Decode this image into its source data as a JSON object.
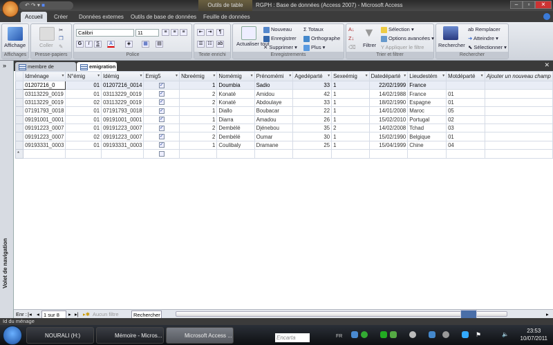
{
  "window": {
    "context_tab": "Outils de table",
    "title": "RGPH : Base de données (Access 2007) - Microsoft Access",
    "min": "–",
    "max": "▫",
    "close": "✕"
  },
  "ribbon_tabs": [
    "Accueil",
    "Créer",
    "Données externes",
    "Outils de base de données",
    "Feuille de données"
  ],
  "ribbon": {
    "affichages": {
      "button": "Affichage",
      "label": "Affichages"
    },
    "presse": {
      "coller": "Coller",
      "label": "Presse-papiers"
    },
    "police": {
      "font": "Calibri",
      "size": "11",
      "bold": "G",
      "italic": "I",
      "underline": "S",
      "color": "A",
      "label": "Police"
    },
    "texte": {
      "label": "Texte enrichi"
    },
    "enreg": {
      "actualiser": "Actualiser tout",
      "nouveau": "Nouveau",
      "enregistrer": "Enregistrer",
      "supprimer": "Supprimer",
      "totaux": "Totaux",
      "orthographe": "Orthographe",
      "plus": "Plus",
      "label": "Enregistrements"
    },
    "trier": {
      "filtrer": "Filtrer",
      "selection": "Sélection",
      "options": "Options avancées",
      "appliquer": "Appliquer le filtre",
      "label": "Trier et filtrer"
    },
    "rech": {
      "rechercher": "Rechercher",
      "remplacer": "Remplacer",
      "atteindre": "Atteindre",
      "selectionner": "Sélectionner",
      "label": "Rechercher"
    }
  },
  "nav_pane": {
    "expand": "»",
    "label": "Volet de navigation"
  },
  "doc_tabs": [
    "membre de ménage",
    "emigration"
  ],
  "table": {
    "columns": [
      "Idménage",
      "N°émig",
      "Idémig",
      "Emig5",
      "Nbreémig",
      "Nomémig",
      "Prénomémi",
      "Agedéparté",
      "Sexeémig",
      "Datedéparté",
      "Lieudestém",
      "Motdéparté",
      "Ajouter un nouveau champ"
    ],
    "rows": [
      [
        "01207216_0",
        "01",
        "01207216_0014",
        true,
        "1",
        "Doumbia",
        "Sadio",
        "33",
        "1",
        "22/02/1999",
        "France",
        ""
      ],
      [
        "03113229_0019",
        "01",
        "03113229_0019",
        true,
        "2",
        "Konaté",
        "Amidou",
        "42",
        "1",
        "14/02/1988",
        "France",
        "01"
      ],
      [
        "03113229_0019",
        "02",
        "03113229_0019",
        true,
        "2",
        "Konaté",
        "Abdoulaye",
        "33",
        "1",
        "18/02/1990",
        "Espagne",
        "01"
      ],
      [
        "07191793_0018",
        "01",
        "07191793_0018",
        true,
        "1",
        "Diallo",
        "Boubacar",
        "22",
        "1",
        "14/01/2008",
        "Maroc",
        "05"
      ],
      [
        "09191001_0001",
        "01",
        "09191001_0001",
        true,
        "1",
        "Diarra",
        "Amadou",
        "26",
        "1",
        "15/02/2010",
        "Portugal",
        "02"
      ],
      [
        "09191223_0007",
        "01",
        "09191223_0007",
        true,
        "2",
        "Dembélé",
        "Djénebou",
        "35",
        "2",
        "14/02/2008",
        "Tchad",
        "03"
      ],
      [
        "09191223_0007",
        "02",
        "09191223_0007",
        true,
        "2",
        "Dembélé",
        "Oumar",
        "30",
        "1",
        "15/02/1990",
        "Belgique",
        "01"
      ],
      [
        "09193331_0003",
        "01",
        "09193331_0003",
        true,
        "1",
        "Coulibaly",
        "Dramane",
        "25",
        "1",
        "15/04/1999",
        "Chine",
        "04"
      ]
    ],
    "new_row_marker": "*"
  },
  "record_nav": {
    "label": "Enr :",
    "position": "1 sur 8",
    "filter": "Aucun filtre",
    "search": "Rechercher"
  },
  "status": "Id du ménage",
  "taskbar": {
    "items": [
      "NOURALI (H:)",
      "Mémoire - Micros...",
      "Microsoft Access ..."
    ],
    "search": "Encarta",
    "lang": "FR",
    "time": "23:53",
    "date": "10/07/2011"
  },
  "colors": {
    "accent": "#2a4a9a",
    "titlebar": "#2a2a2a"
  }
}
